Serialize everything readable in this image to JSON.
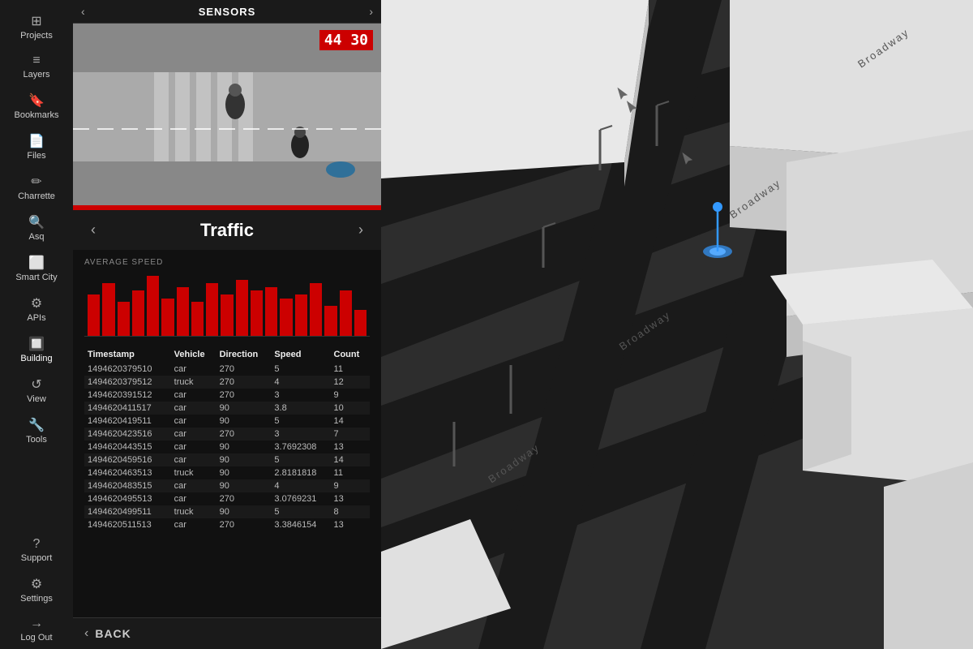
{
  "sidebar": {
    "items": [
      {
        "id": "projects",
        "label": "Projects",
        "icon": "⊞"
      },
      {
        "id": "layers",
        "label": "Layers",
        "icon": "≡"
      },
      {
        "id": "bookmarks",
        "label": "Bookmarks",
        "icon": "🔖"
      },
      {
        "id": "files",
        "label": "Files",
        "icon": "📄"
      },
      {
        "id": "charrette",
        "label": "Charrette",
        "icon": "✏"
      },
      {
        "id": "asq",
        "label": "Asq",
        "icon": "🔍"
      },
      {
        "id": "smart-city",
        "label": "Smart City",
        "icon": "⬜"
      },
      {
        "id": "apis",
        "label": "APIs",
        "icon": "⚙"
      },
      {
        "id": "building",
        "label": "Building",
        "icon": "🔲"
      },
      {
        "id": "view",
        "label": "View",
        "icon": "↺"
      },
      {
        "id": "tools",
        "label": "Tools",
        "icon": "🔧"
      }
    ],
    "bottom": [
      {
        "id": "support",
        "label": "Support",
        "icon": "?"
      },
      {
        "id": "settings",
        "label": "Settings",
        "icon": "⚙"
      },
      {
        "id": "logout",
        "label": "Log Out",
        "icon": "→"
      }
    ]
  },
  "panel": {
    "header_title": "SENSORS",
    "traffic_title": "Traffic",
    "avg_speed_label": "AVERAGE SPEED",
    "timestamp_display": "44 30",
    "chart_bars": [
      55,
      70,
      45,
      60,
      80,
      50,
      65,
      45,
      70,
      55,
      75,
      60,
      65,
      50,
      55,
      70,
      40,
      60,
      35
    ],
    "table": {
      "columns": [
        "Timestamp",
        "Vehicle",
        "Direction",
        "Speed",
        "Count"
      ],
      "rows": [
        [
          "1494620379510",
          "car",
          "270",
          "5",
          "11"
        ],
        [
          "1494620379512",
          "truck",
          "270",
          "4",
          "12"
        ],
        [
          "1494620391512",
          "car",
          "270",
          "3",
          "9"
        ],
        [
          "1494620411517",
          "car",
          "90",
          "3.8",
          "10"
        ],
        [
          "1494620419511",
          "car",
          "90",
          "5",
          "14"
        ],
        [
          "1494620423516",
          "car",
          "270",
          "3",
          "7"
        ],
        [
          "1494620443515",
          "car",
          "90",
          "3.7692308",
          "13"
        ],
        [
          "1494620459516",
          "car",
          "90",
          "5",
          "14"
        ],
        [
          "1494620463513",
          "truck",
          "90",
          "2.8181818",
          "11"
        ],
        [
          "1494620483515",
          "car",
          "90",
          "4",
          "9"
        ],
        [
          "1494620495513",
          "car",
          "270",
          "3.0769231",
          "13"
        ],
        [
          "1494620499511",
          "truck",
          "90",
          "5",
          "8"
        ],
        [
          "1494620511513",
          "car",
          "270",
          "3.3846154",
          "13"
        ]
      ]
    },
    "back_label": "BACK"
  }
}
